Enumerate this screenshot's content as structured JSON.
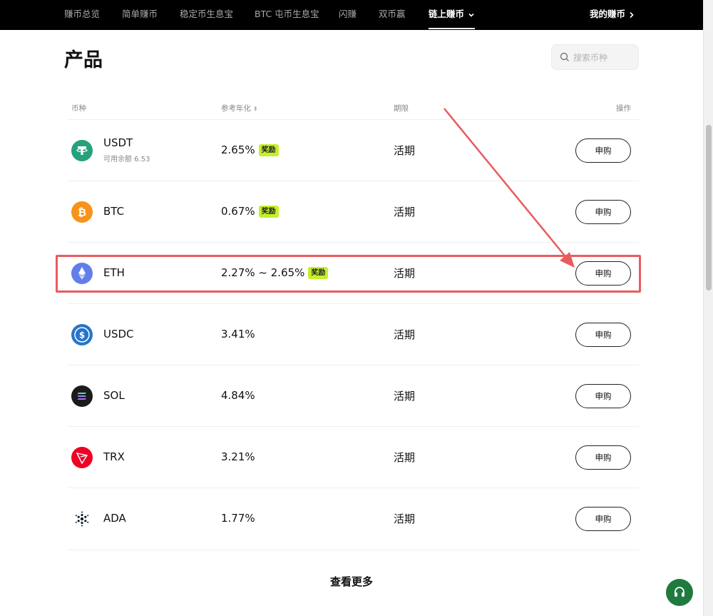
{
  "nav": {
    "items": [
      {
        "label": "赚币总览"
      },
      {
        "label": "简单赚币"
      },
      {
        "label": "稳定币生息宝"
      },
      {
        "label": "BTC 屯币生息宝"
      },
      {
        "label": "闪赚"
      },
      {
        "label": "双币赢"
      },
      {
        "label": "链上赚币",
        "active": true
      }
    ],
    "right_label": "我的赚币"
  },
  "page": {
    "title": "产品"
  },
  "search": {
    "placeholder": "搜索币种"
  },
  "table": {
    "headers": {
      "coin": "币种",
      "apy": "参考年化",
      "term": "期限",
      "action": "操作"
    },
    "rows": [
      {
        "coin": "USDT",
        "sub": "可用余额 6.53",
        "apy": "2.65%",
        "badge": "奖励",
        "term": "活期",
        "action": "申购",
        "icon": "usdt-icon",
        "color": "#26a17b"
      },
      {
        "coin": "BTC",
        "sub": "",
        "apy": "0.67%",
        "badge": "奖励",
        "term": "活期",
        "action": "申购",
        "icon": "btc-icon",
        "color": "#f7931a"
      },
      {
        "coin": "ETH",
        "sub": "",
        "apy": "2.27% ~ 2.65%",
        "badge": "奖励",
        "term": "活期",
        "action": "申购",
        "icon": "eth-icon",
        "color": "#627eea"
      },
      {
        "coin": "USDC",
        "sub": "",
        "apy": "3.41%",
        "badge": "",
        "term": "活期",
        "action": "申购",
        "icon": "usdc-icon",
        "color": "#2775ca"
      },
      {
        "coin": "SOL",
        "sub": "",
        "apy": "4.84%",
        "badge": "",
        "term": "活期",
        "action": "申购",
        "icon": "sol-icon",
        "color": "#1b1b1b"
      },
      {
        "coin": "TRX",
        "sub": "",
        "apy": "3.21%",
        "badge": "",
        "term": "活期",
        "action": "申购",
        "icon": "trx-icon",
        "color": "#ef0027"
      },
      {
        "coin": "ADA",
        "sub": "",
        "apy": "1.77%",
        "badge": "",
        "term": "活期",
        "action": "申购",
        "icon": "ada-icon",
        "color": "#0d1e30"
      }
    ]
  },
  "more": {
    "label": "查看更多"
  },
  "colors": {
    "accent_badge": "#c4f02c",
    "highlight": "#e85c5e",
    "support": "#1f7a3f"
  }
}
